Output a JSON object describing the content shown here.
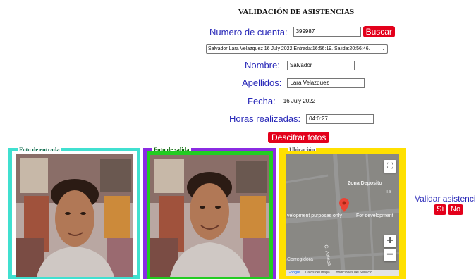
{
  "page": {
    "title": "VALIDACIÓN DE ASISTENCIAS"
  },
  "form": {
    "cuenta_label": "Numero de cuenta:",
    "cuenta_value": "399987",
    "buscar_button": "Buscar",
    "registro_selected": "Salvador Lara Velazquez 16 July 2022 Entrada:16:56:19. Salida:20:56:46.",
    "nombre_label": "Nombre:",
    "nombre_value": "Salvador",
    "apellidos_label": "Apellidos:",
    "apellidos_value": "Lara Velazquez",
    "fecha_label": "Fecha:",
    "fecha_value": "16 July 2022",
    "horas_label": "Horas realizadas:",
    "horas_value": "04:0:27",
    "descifrar_button": "Descifrar fotos"
  },
  "panels": {
    "entrada": {
      "legend": "Foto de entrada",
      "color": "#40e0d0"
    },
    "salida": {
      "legend": "Foto de salida",
      "color": "#8a2be2",
      "inner_color": "#22cc22"
    },
    "ubicacion": {
      "legend": "Ubicación",
      "color": "#ffe000"
    }
  },
  "map": {
    "place_label": "Zona Deposito",
    "watermark_left": "velopment purposes only",
    "watermark_right": "For development",
    "street_1": "C. Azteca",
    "street_2": "Corregidora",
    "footer_1": "Datos del mapa",
    "footer_2": "Condiciones del Servicio",
    "zoom_in": "+",
    "zoom_out": "−",
    "fullscreen": "⛶",
    "partial_label": "Ta"
  },
  "validation": {
    "label": "Validar asistencia",
    "yes_button": "Sí",
    "no_button": "No"
  },
  "icons": {
    "map_pin": "pin-icon",
    "fullscreen": "fullscreen-icon",
    "zoom_in": "plus-icon",
    "zoom_out": "minus-icon",
    "dropdown": "chevron-down-icon"
  }
}
